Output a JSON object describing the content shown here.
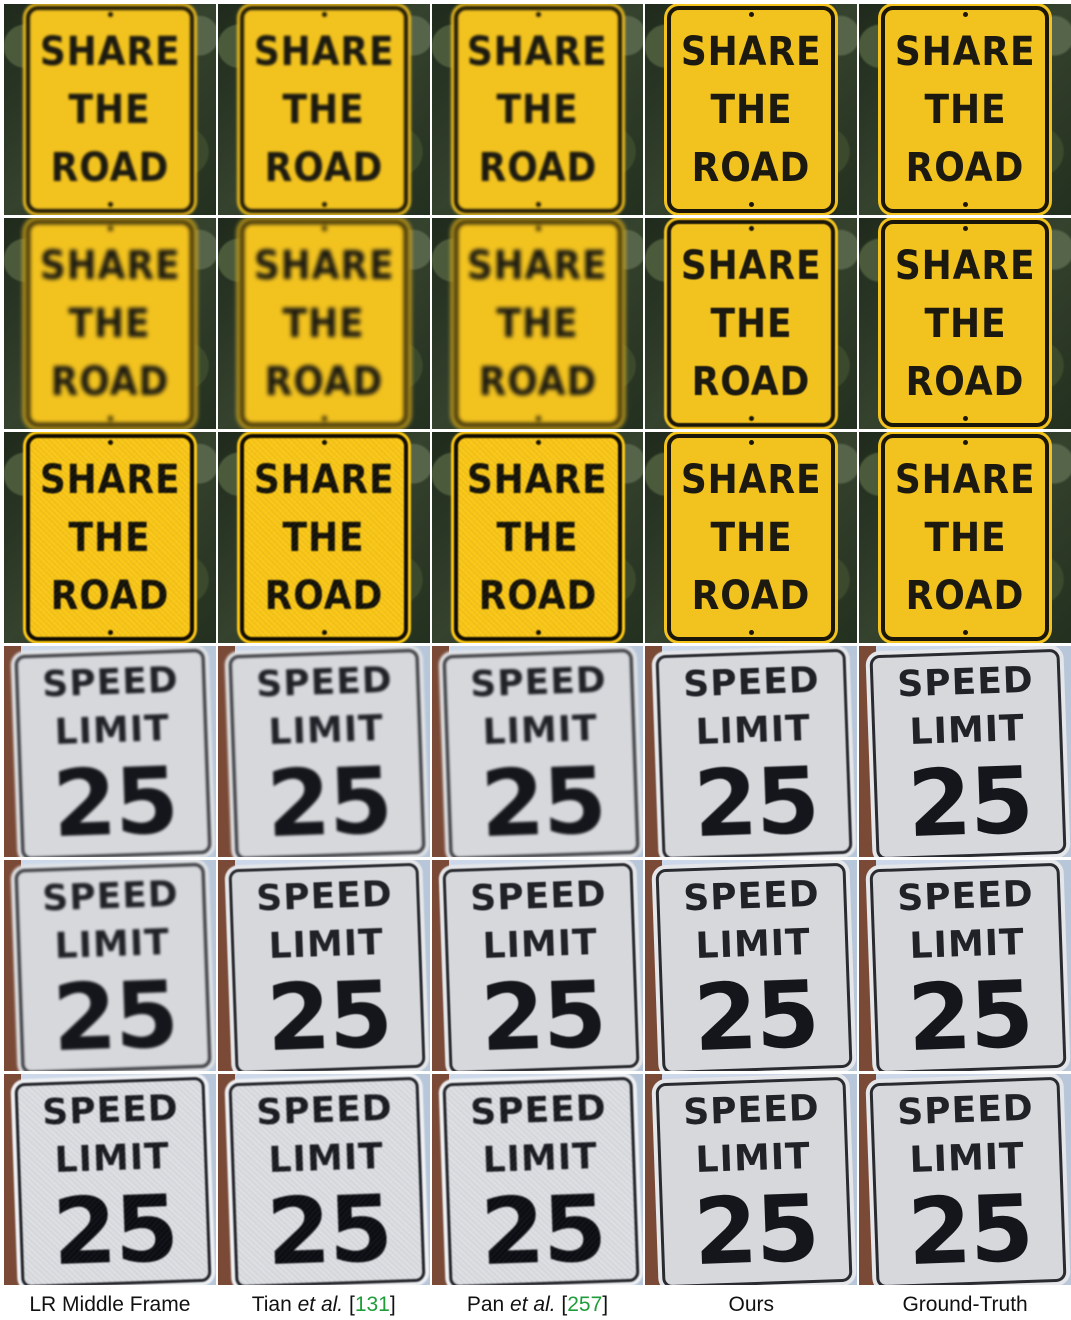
{
  "rows": [
    {
      "sign": "yellow",
      "text": [
        "SHARE",
        "THE",
        "ROAD"
      ]
    },
    {
      "sign": "yellow",
      "text": [
        "SHARE",
        "THE",
        "ROAD"
      ]
    },
    {
      "sign": "yellow",
      "text": [
        "SHARE",
        "THE",
        "ROAD"
      ]
    },
    {
      "sign": "white",
      "text": [
        "SPEED",
        "LIMIT",
        "25"
      ]
    },
    {
      "sign": "white",
      "text": [
        "SPEED",
        "LIMIT",
        "25"
      ]
    },
    {
      "sign": "white",
      "text": [
        "SPEED",
        "LIMIT",
        "25"
      ]
    }
  ],
  "quality": [
    [
      "q-blur1",
      "q-blur1",
      "q-blur1",
      "q-sharp",
      "q-sharp"
    ],
    [
      "q-blur2",
      "q-blur2",
      "q-blur2",
      "q-soft",
      "q-sharp"
    ],
    [
      "q-noisy",
      "q-noisy",
      "q-noisy",
      "q-sharp",
      "q-sharp"
    ],
    [
      "q-blur1",
      "q-blur1",
      "q-blur1",
      "q-soft",
      "q-sharp"
    ],
    [
      "q-blur1",
      "q-soft",
      "q-soft",
      "q-sharp",
      "q-sharp"
    ],
    [
      "q-noisy",
      "q-noisy",
      "q-noisy",
      "q-sharp",
      "q-sharp"
    ]
  ],
  "columns": [
    {
      "name": "LR Middle Frame"
    },
    {
      "name": "Tian",
      "italic": "et al.",
      "ref": "131"
    },
    {
      "name": "Pan",
      "italic": "et al.",
      "ref": "257"
    },
    {
      "name": "Ours"
    },
    {
      "name": "Ground-Truth"
    }
  ],
  "colors": {
    "sign_yellow": "#f2c21f",
    "sign_white": "#d6d8dc",
    "citation": "#1f9d3a"
  }
}
